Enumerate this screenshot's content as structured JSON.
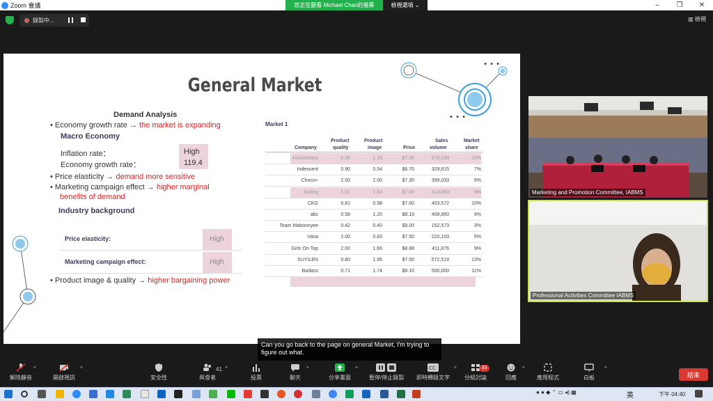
{
  "window": {
    "app_title": "Zoom 會議",
    "share_banner": "您正在觀看 Michael  Chan的螢幕",
    "view_options": "檢視選項 ⌄",
    "minimize": "–",
    "restore": "❐",
    "close": "✕"
  },
  "top": {
    "recording_label": "錄製中...",
    "view_label": "檢視"
  },
  "slide": {
    "title": "General Market",
    "demand_heading": "Demand Analysis",
    "bullet1_prefix": "• Economy growth rate → ",
    "bullet1_red": "the market is expanding",
    "macro_heading": "Macro Economy",
    "inflation_label": "Inflation rate：",
    "inflation_value": "High",
    "growth_label": "Economy growth rate：",
    "growth_value": "119.4",
    "bullet2_prefix": "• Price elasticity → ",
    "bullet2_red": "demand more sensitive",
    "bullet3_prefix": "• Marketing campaign effect → ",
    "bullet3_red_1": "higher marginal",
    "bullet3_red_2": "benefits of demand",
    "industry_heading": "Industry background",
    "ind_row1_label": "Price elasticity:",
    "ind_row1_value": "High",
    "ind_row2_label": "Marketing campaign effect:",
    "ind_row2_value": "High",
    "bullet4_prefix": "• Product image & quality → ",
    "bullet4_red": "higher bargaining power",
    "market_label": "Market 1",
    "table_headers": {
      "company": "Company",
      "quality_1": "Product",
      "quality_2": "quality",
      "image_1": "Product",
      "image_2": "image",
      "price": "Price",
      "volume_1": "Sales",
      "volume_2": "volume",
      "share_1": "Market",
      "share_2": "share"
    },
    "table_rows": [
      {
        "company": "Kickstarters",
        "quality": "0.35",
        "image": "1.19",
        "price": "$7.30",
        "volume": "570,199",
        "share": "13%",
        "highlight": true
      },
      {
        "company": "Iridescent",
        "quality": "0.90",
        "image": "0.54",
        "price": "$6.70",
        "volume": "329,815",
        "share": "7%",
        "highlight": false
      },
      {
        "company": "Choco+",
        "quality": "2.00",
        "image": "2.00",
        "price": "$7.30",
        "volume": "399,033",
        "share": "9%",
        "highlight": false
      },
      {
        "company": "Sailing",
        "quality": "1.61",
        "image": "1.63",
        "price": "$7.00",
        "volume": "414,860",
        "share": "9%",
        "highlight": true
      },
      {
        "company": "CKG",
        "quality": "0.81",
        "image": "0.98",
        "price": "$7.60",
        "volume": "453,572",
        "share": "10%",
        "highlight": false
      },
      {
        "company": "abc",
        "quality": "0.58",
        "image": "1.20",
        "price": "$8.15",
        "volume": "408,860",
        "share": "9%",
        "highlight": false
      },
      {
        "company": "Team Mabonnyee",
        "quality": "0.42",
        "image": "0.40",
        "price": "$9.00",
        "volume": "152,573",
        "share": "3%",
        "highlight": false
      },
      {
        "company": "Varia",
        "quality": "2.00",
        "image": "0.83",
        "price": "$7.50",
        "volume": "220,103",
        "share": "5%",
        "highlight": false
      },
      {
        "company": "Girls On Top",
        "quality": "2.00",
        "image": "1.66",
        "price": "$8.88",
        "volume": "411,876",
        "share": "9%",
        "highlight": false
      },
      {
        "company": "SUYILEN",
        "quality": "0.80",
        "image": "1.95",
        "price": "$7.50",
        "volume": "572,519",
        "share": "13%",
        "highlight": false
      },
      {
        "company": "Badass",
        "quality": "0.71",
        "image": "1.74",
        "price": "$8.10",
        "volume": "500,000",
        "share": "11%",
        "highlight": false
      }
    ]
  },
  "videos": {
    "top_label": "Marketing and Promotion Committee, IABMS",
    "bottom_label": "Professional Activities Committee IABMS"
  },
  "caption": "Can you go back to the page on general Market, I'm trying to figure out what.",
  "toolbar": {
    "unmute": "解除靜音",
    "start_video": "開啟視訊",
    "security": "安全性",
    "participants": "與會者",
    "participants_count": "41",
    "polls": "投票",
    "chat": "聊天",
    "share_screen": "分享畫面",
    "pause_share": "暫停/停止錄製",
    "live_transcript": "即時轉錄文字",
    "breakout": "分組討論",
    "breakout_count": "33",
    "reactions": "回應",
    "apps": "應用程式",
    "whiteboard": "白板",
    "end": "結束"
  },
  "taskbar": {
    "ime": "英",
    "time": "下午 04:40"
  },
  "colors": {
    "zoom_green": "#23b14d",
    "end_red": "#d83a32",
    "pink_highlight": "#ecd3dc",
    "accent_blue": "#3aa0e0",
    "speaker_border": "#c8e34a"
  }
}
